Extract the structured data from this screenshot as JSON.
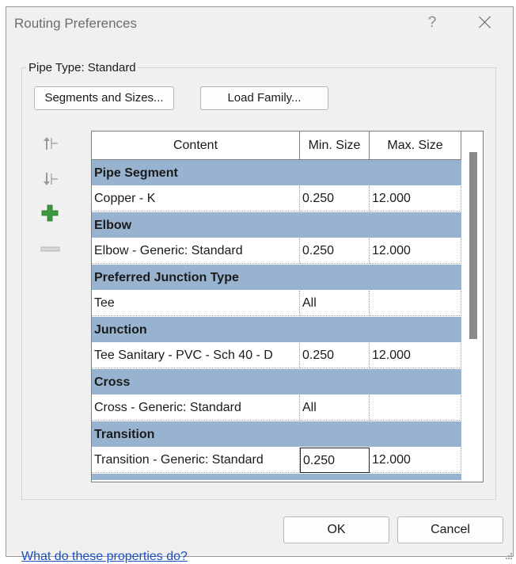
{
  "dialog": {
    "title": "Routing Preferences",
    "help_label": "?",
    "pipe_type_label": "Pipe Type: Standard",
    "segments_button": "Segments and Sizes...",
    "load_family_button": "Load Family...",
    "ok_button": "OK",
    "cancel_button": "Cancel",
    "help_link": "What do these properties do?"
  },
  "side_icons": [
    "move-up-icon",
    "move-down-icon",
    "add-row-icon",
    "remove-row-icon"
  ],
  "colors": {
    "group_header": "#98b3d0",
    "add_icon": "#3c9a3c",
    "link": "#1a4fbf"
  },
  "table": {
    "columns": [
      "Content",
      "Min. Size",
      "Max. Size"
    ],
    "groups": [
      {
        "header": "Pipe Segment",
        "rows": [
          {
            "content": "Copper - K",
            "min": "0.250",
            "max": "12.000"
          }
        ]
      },
      {
        "header": "Elbow",
        "rows": [
          {
            "content": "Elbow - Generic: Standard",
            "min": "0.250",
            "max": "12.000"
          }
        ]
      },
      {
        "header": "Preferred Junction Type",
        "rows": [
          {
            "content": "Tee",
            "min": "All",
            "max": ""
          }
        ]
      },
      {
        "header": "Junction",
        "rows": [
          {
            "content": "Tee Sanitary - PVC - Sch 40 - D",
            "min": "0.250",
            "max": "12.000"
          }
        ]
      },
      {
        "header": "Cross",
        "rows": [
          {
            "content": "Cross - Generic: Standard",
            "min": "All",
            "max": ""
          }
        ]
      },
      {
        "header": "Transition",
        "rows": [
          {
            "content": "Transition - Generic: Standard",
            "min": "0.250",
            "max": "12.000"
          }
        ]
      }
    ]
  }
}
